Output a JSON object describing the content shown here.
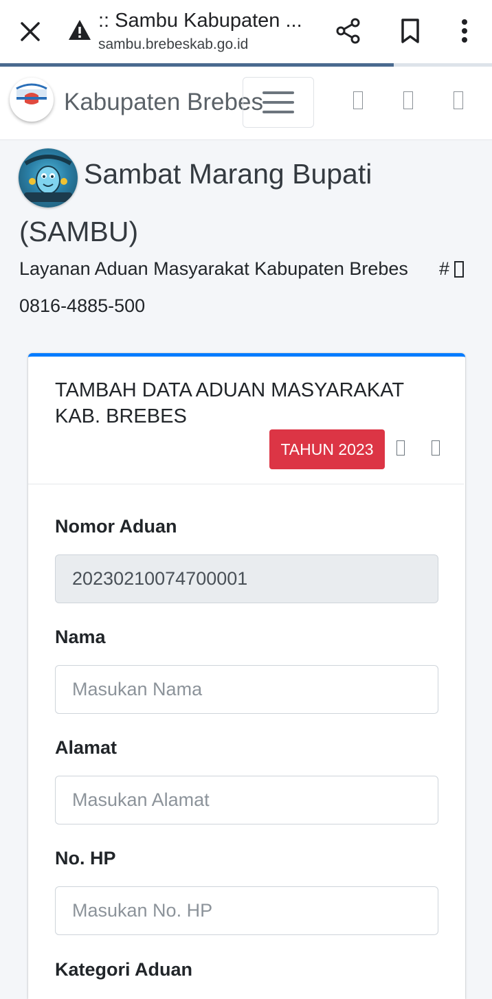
{
  "browser": {
    "tab_title": ":: Sambu Kabupaten ...",
    "url": "sambu.brebeskab.go.id",
    "load_progress_percent": 80,
    "icons": [
      "close-icon",
      "warning-icon",
      "share-icon",
      "bookmark-icon",
      "more-vert-icon"
    ]
  },
  "navbar": {
    "brand": "Kabupaten Brebes",
    "icons": [
      "logo-image",
      "menu-icon",
      "missing-glyph-icon",
      "missing-glyph-icon",
      "missing-glyph-icon"
    ]
  },
  "header": {
    "title_line1": "Sambat Marang Bupati",
    "title_line2": "(SAMBU)",
    "subtitle": "Layanan Aduan Masyarakat Kabupaten Brebes",
    "hash_label": "#",
    "phone": "0816-4885-500"
  },
  "card": {
    "title": "TAMBAH DATA ADUAN MASYARAKAT KAB. BREBES",
    "year_badge": "TAHUN 2023",
    "fields": [
      {
        "label": "Nomor Aduan",
        "value": "20230210074700001",
        "placeholder": ""
      },
      {
        "label": "Nama",
        "value": "",
        "placeholder": "Masukan Nama"
      },
      {
        "label": "Alamat",
        "value": "",
        "placeholder": "Masukan Alamat"
      },
      {
        "label": "No. HP",
        "value": "",
        "placeholder": "Masukan No. HP"
      },
      {
        "label": "Kategori Aduan"
      }
    ]
  },
  "colors": {
    "card_accent": "#007bff",
    "badge": "#dc3545",
    "progress": "#4a6a8f",
    "page_bg": "#f4f6f9"
  }
}
